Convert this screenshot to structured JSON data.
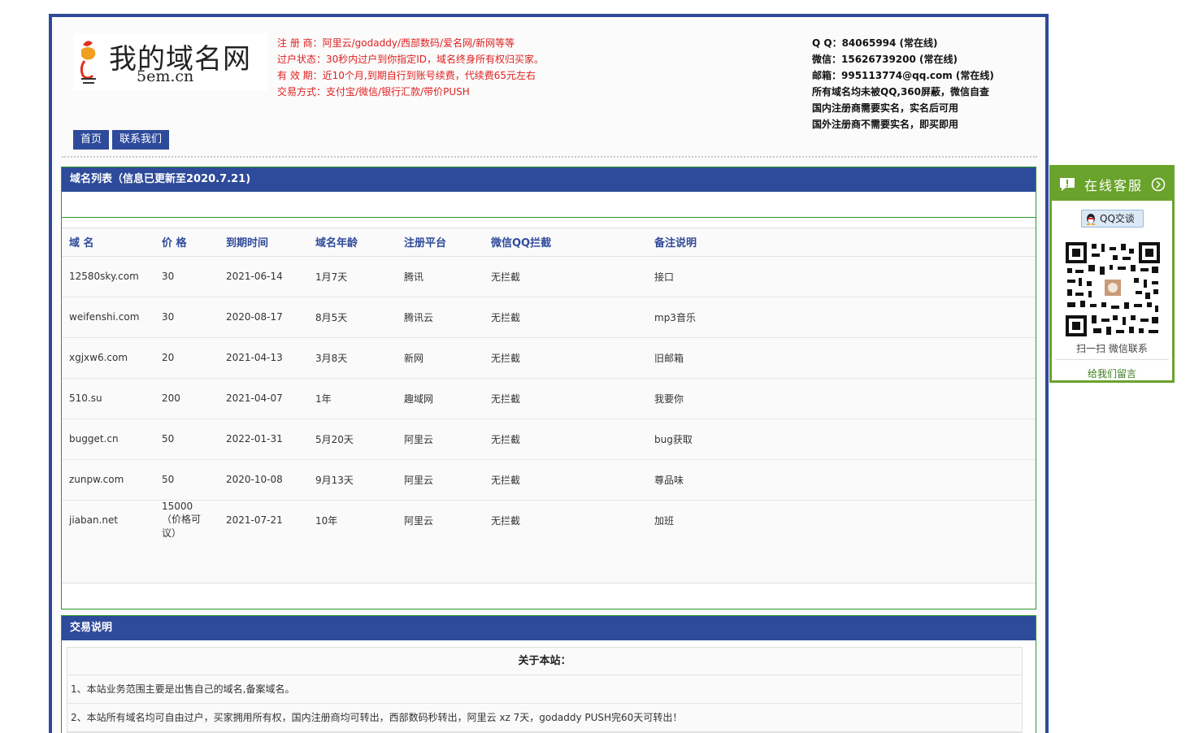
{
  "logo": {
    "title_cn": "我的域名网",
    "subtitle_en": "5em.cn"
  },
  "notice": [
    "注 册 商：阿里云/godaddy/西部数码/爱名网/新网等等",
    "过户状态：30秒内过户到你指定ID，域名终身所有权归买家。",
    "有 效 期：近10个月,到期自行到账号续费，代续费65元左右",
    "交易方式：支付宝/微信/银行汇款/带价PUSH"
  ],
  "contact": [
    "Q Q：84065994 (常在线)",
    "微信：15626739200 (常在线)",
    "邮箱：995113774@qq.com (常在线)",
    "所有域名均未被QQ,360屏蔽，微信自查",
    "国内注册商需要实名，实名后可用",
    "国外注册商不需要实名，即买即用"
  ],
  "nav": [
    "首页",
    "联系我们"
  ],
  "domain_panel": {
    "title": "域名列表（信息已更新至2020.7.21)",
    "columns": [
      "域 名",
      "价 格",
      "到期时间",
      "域名年龄",
      "注册平台",
      "微信QQ拦截",
      "备注说明"
    ],
    "rows": [
      [
        "12580sky.com",
        "30",
        "2021-06-14",
        "1月7天",
        "腾讯",
        "无拦截",
        "接口"
      ],
      [
        "weifenshi.com",
        "30",
        "2020-08-17",
        "8月5天",
        "腾讯云",
        "无拦截",
        "mp3音乐"
      ],
      [
        "xgjxw6.com",
        "20",
        "2021-04-13",
        "3月8天",
        "新网",
        "无拦截",
        "旧邮箱"
      ],
      [
        "510.su",
        "200",
        "2021-04-07",
        "1年",
        "趣域网",
        "无拦截",
        "我要你"
      ],
      [
        "bugget.cn",
        "50",
        "2022-01-31",
        "5月20天",
        "阿里云",
        "无拦截",
        "bug获取"
      ],
      [
        "zunpw.com",
        "50",
        "2020-10-08",
        "9月13天",
        "阿里云",
        "无拦截",
        "尊品味"
      ],
      [
        "jiaban.net",
        "15000（价格可议）",
        "2021-07-21",
        "10年",
        "阿里云",
        "无拦截",
        "加班"
      ]
    ]
  },
  "trade_panel": {
    "title": "交易说明",
    "about": "关于本站：",
    "items": [
      "1、本站业务范围主要是出售自己的域名,备案域名。",
      "2、本站所有域名均可自由过户，买家拥用所有权，国内注册商均可转出，西部数码秒转出，阿里云 xz 7天，godaddy PUSH完60天可转出！"
    ]
  },
  "service": {
    "title": "在线客服",
    "qq_button": "QQ交谈",
    "scan_text": "扫一扫 微信联系",
    "message_link": "给我们留言"
  },
  "colors": {
    "nav_blue": "#2e4a9a",
    "panel_green": "#2c9a2c",
    "notice_red": "#e02020",
    "service_green": "#6aa32c"
  }
}
